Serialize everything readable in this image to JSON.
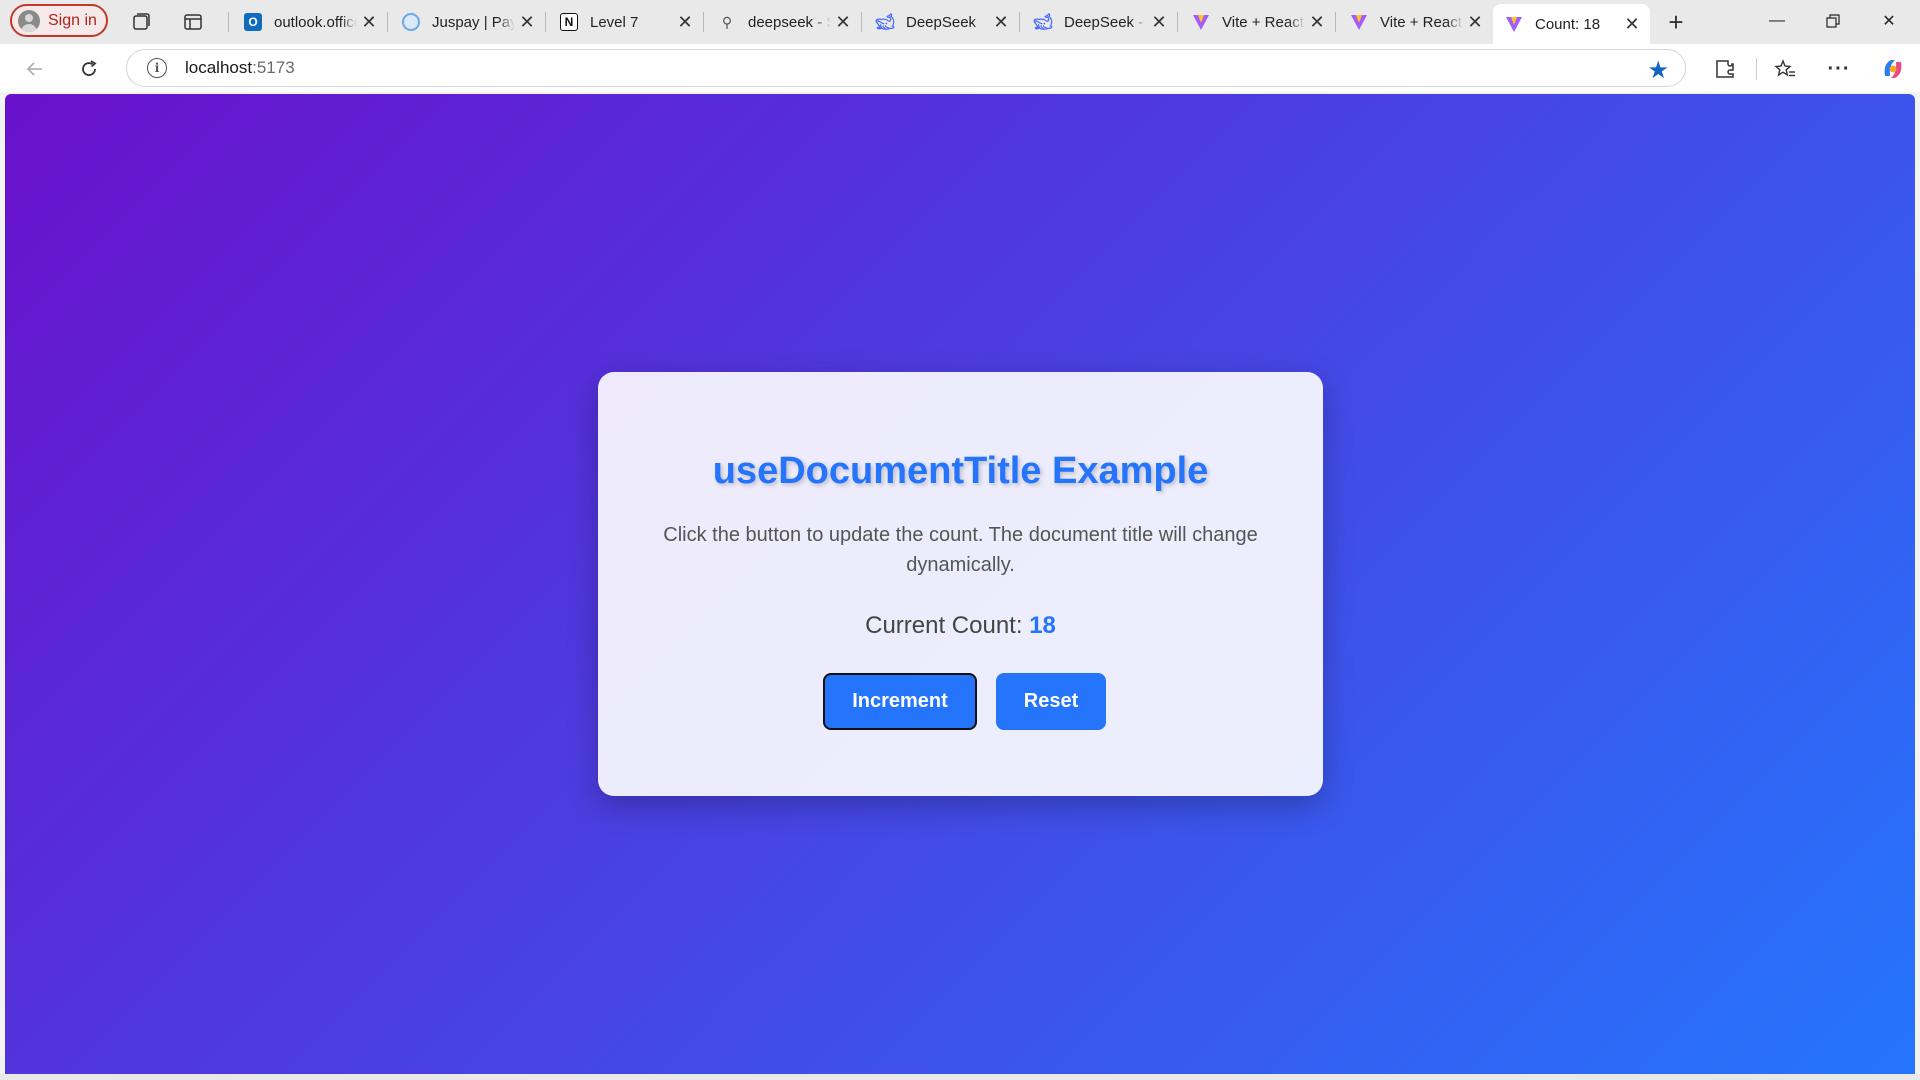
{
  "browser": {
    "signin_label": "Sign in",
    "tabs": [
      {
        "title": "outlook.office.com",
        "favicon": "outlook-icon",
        "active": false
      },
      {
        "title": "Juspay | Payments",
        "favicon": "juspay-icon",
        "active": false
      },
      {
        "title": "Level 7",
        "favicon": "notion-icon",
        "active": false
      },
      {
        "title": "deepseek - Search",
        "favicon": "search-icon",
        "active": false
      },
      {
        "title": "DeepSeek",
        "favicon": "deepseek-icon",
        "active": false
      },
      {
        "title": "DeepSeek - Into the Unknown",
        "favicon": "deepseek-icon",
        "active": false
      },
      {
        "title": "Vite + React",
        "favicon": "vite-icon",
        "active": false
      },
      {
        "title": "Vite + React",
        "favicon": "vite-icon",
        "active": false
      },
      {
        "title": "Count: 18",
        "favicon": "vite-icon",
        "active": true
      }
    ],
    "address": {
      "host": "localhost",
      "port": ":5173"
    },
    "accent": "#1565c0"
  },
  "page": {
    "gradient_start": "#6a11cb",
    "gradient_end": "#2575fc",
    "title": "useDocumentTitle Example",
    "description": "Click the button to update the count. The document title will change dynamically.",
    "count_label": "Current Count:",
    "count_value": "18",
    "increment_label": "Increment",
    "reset_label": "Reset",
    "accent": "#2575fc"
  }
}
